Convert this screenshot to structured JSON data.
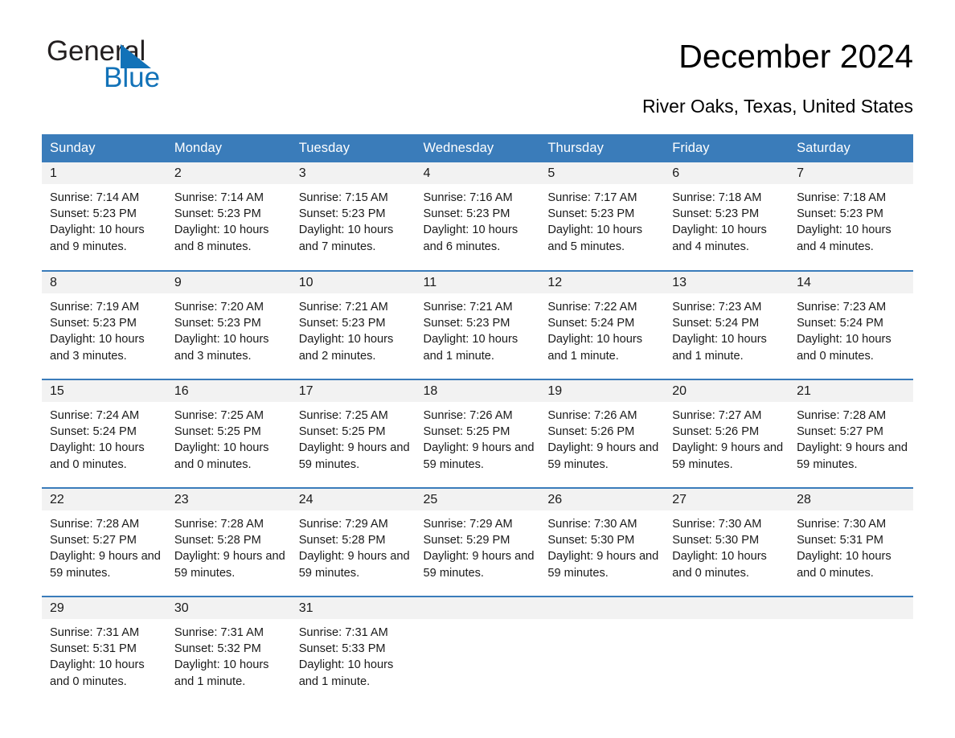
{
  "brand": {
    "name_part1": "General",
    "name_part2": "Blue",
    "accent_color": "#1272b8"
  },
  "header": {
    "title": "December 2024",
    "location": "River Oaks, Texas, United States"
  },
  "calendar": {
    "header_bg": "#3a7cba",
    "daynum_bg": "#f2f2f2",
    "weekday_headers": [
      "Sunday",
      "Monday",
      "Tuesday",
      "Wednesday",
      "Thursday",
      "Friday",
      "Saturday"
    ],
    "weeks": [
      [
        {
          "day": "1",
          "sunrise": "Sunrise: 7:14 AM",
          "sunset": "Sunset: 5:23 PM",
          "daylight": "Daylight: 10 hours and 9 minutes."
        },
        {
          "day": "2",
          "sunrise": "Sunrise: 7:14 AM",
          "sunset": "Sunset: 5:23 PM",
          "daylight": "Daylight: 10 hours and 8 minutes."
        },
        {
          "day": "3",
          "sunrise": "Sunrise: 7:15 AM",
          "sunset": "Sunset: 5:23 PM",
          "daylight": "Daylight: 10 hours and 7 minutes."
        },
        {
          "day": "4",
          "sunrise": "Sunrise: 7:16 AM",
          "sunset": "Sunset: 5:23 PM",
          "daylight": "Daylight: 10 hours and 6 minutes."
        },
        {
          "day": "5",
          "sunrise": "Sunrise: 7:17 AM",
          "sunset": "Sunset: 5:23 PM",
          "daylight": "Daylight: 10 hours and 5 minutes."
        },
        {
          "day": "6",
          "sunrise": "Sunrise: 7:18 AM",
          "sunset": "Sunset: 5:23 PM",
          "daylight": "Daylight: 10 hours and 4 minutes."
        },
        {
          "day": "7",
          "sunrise": "Sunrise: 7:18 AM",
          "sunset": "Sunset: 5:23 PM",
          "daylight": "Daylight: 10 hours and 4 minutes."
        }
      ],
      [
        {
          "day": "8",
          "sunrise": "Sunrise: 7:19 AM",
          "sunset": "Sunset: 5:23 PM",
          "daylight": "Daylight: 10 hours and 3 minutes."
        },
        {
          "day": "9",
          "sunrise": "Sunrise: 7:20 AM",
          "sunset": "Sunset: 5:23 PM",
          "daylight": "Daylight: 10 hours and 3 minutes."
        },
        {
          "day": "10",
          "sunrise": "Sunrise: 7:21 AM",
          "sunset": "Sunset: 5:23 PM",
          "daylight": "Daylight: 10 hours and 2 minutes."
        },
        {
          "day": "11",
          "sunrise": "Sunrise: 7:21 AM",
          "sunset": "Sunset: 5:23 PM",
          "daylight": "Daylight: 10 hours and 1 minute."
        },
        {
          "day": "12",
          "sunrise": "Sunrise: 7:22 AM",
          "sunset": "Sunset: 5:24 PM",
          "daylight": "Daylight: 10 hours and 1 minute."
        },
        {
          "day": "13",
          "sunrise": "Sunrise: 7:23 AM",
          "sunset": "Sunset: 5:24 PM",
          "daylight": "Daylight: 10 hours and 1 minute."
        },
        {
          "day": "14",
          "sunrise": "Sunrise: 7:23 AM",
          "sunset": "Sunset: 5:24 PM",
          "daylight": "Daylight: 10 hours and 0 minutes."
        }
      ],
      [
        {
          "day": "15",
          "sunrise": "Sunrise: 7:24 AM",
          "sunset": "Sunset: 5:24 PM",
          "daylight": "Daylight: 10 hours and 0 minutes."
        },
        {
          "day": "16",
          "sunrise": "Sunrise: 7:25 AM",
          "sunset": "Sunset: 5:25 PM",
          "daylight": "Daylight: 10 hours and 0 minutes."
        },
        {
          "day": "17",
          "sunrise": "Sunrise: 7:25 AM",
          "sunset": "Sunset: 5:25 PM",
          "daylight": "Daylight: 9 hours and 59 minutes."
        },
        {
          "day": "18",
          "sunrise": "Sunrise: 7:26 AM",
          "sunset": "Sunset: 5:25 PM",
          "daylight": "Daylight: 9 hours and 59 minutes."
        },
        {
          "day": "19",
          "sunrise": "Sunrise: 7:26 AM",
          "sunset": "Sunset: 5:26 PM",
          "daylight": "Daylight: 9 hours and 59 minutes."
        },
        {
          "day": "20",
          "sunrise": "Sunrise: 7:27 AM",
          "sunset": "Sunset: 5:26 PM",
          "daylight": "Daylight: 9 hours and 59 minutes."
        },
        {
          "day": "21",
          "sunrise": "Sunrise: 7:28 AM",
          "sunset": "Sunset: 5:27 PM",
          "daylight": "Daylight: 9 hours and 59 minutes."
        }
      ],
      [
        {
          "day": "22",
          "sunrise": "Sunrise: 7:28 AM",
          "sunset": "Sunset: 5:27 PM",
          "daylight": "Daylight: 9 hours and 59 minutes."
        },
        {
          "day": "23",
          "sunrise": "Sunrise: 7:28 AM",
          "sunset": "Sunset: 5:28 PM",
          "daylight": "Daylight: 9 hours and 59 minutes."
        },
        {
          "day": "24",
          "sunrise": "Sunrise: 7:29 AM",
          "sunset": "Sunset: 5:28 PM",
          "daylight": "Daylight: 9 hours and 59 minutes."
        },
        {
          "day": "25",
          "sunrise": "Sunrise: 7:29 AM",
          "sunset": "Sunset: 5:29 PM",
          "daylight": "Daylight: 9 hours and 59 minutes."
        },
        {
          "day": "26",
          "sunrise": "Sunrise: 7:30 AM",
          "sunset": "Sunset: 5:30 PM",
          "daylight": "Daylight: 9 hours and 59 minutes."
        },
        {
          "day": "27",
          "sunrise": "Sunrise: 7:30 AM",
          "sunset": "Sunset: 5:30 PM",
          "daylight": "Daylight: 10 hours and 0 minutes."
        },
        {
          "day": "28",
          "sunrise": "Sunrise: 7:30 AM",
          "sunset": "Sunset: 5:31 PM",
          "daylight": "Daylight: 10 hours and 0 minutes."
        }
      ],
      [
        {
          "day": "29",
          "sunrise": "Sunrise: 7:31 AM",
          "sunset": "Sunset: 5:31 PM",
          "daylight": "Daylight: 10 hours and 0 minutes."
        },
        {
          "day": "30",
          "sunrise": "Sunrise: 7:31 AM",
          "sunset": "Sunset: 5:32 PM",
          "daylight": "Daylight: 10 hours and 1 minute."
        },
        {
          "day": "31",
          "sunrise": "Sunrise: 7:31 AM",
          "sunset": "Sunset: 5:33 PM",
          "daylight": "Daylight: 10 hours and 1 minute."
        },
        {
          "day": "",
          "sunrise": "",
          "sunset": "",
          "daylight": ""
        },
        {
          "day": "",
          "sunrise": "",
          "sunset": "",
          "daylight": ""
        },
        {
          "day": "",
          "sunrise": "",
          "sunset": "",
          "daylight": ""
        },
        {
          "day": "",
          "sunrise": "",
          "sunset": "",
          "daylight": ""
        }
      ]
    ]
  }
}
